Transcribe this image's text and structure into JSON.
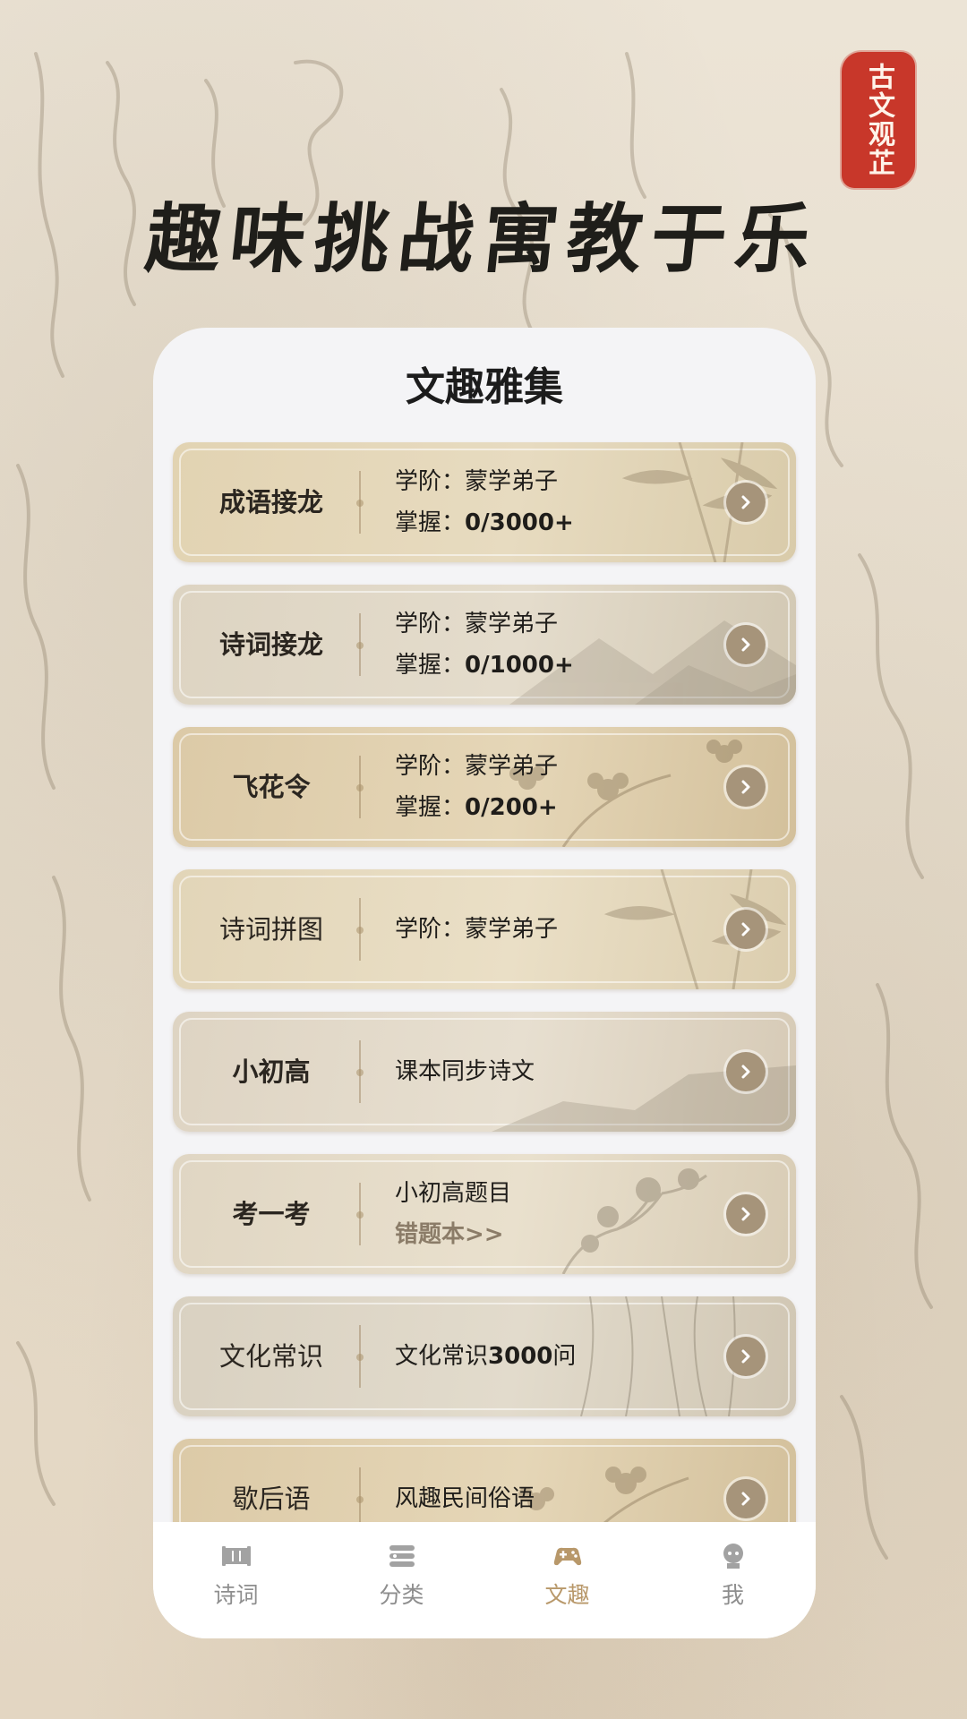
{
  "seal": {
    "text": "古文观芷"
  },
  "headline": "趣味挑战寓教于乐",
  "card": {
    "title": "文趣雅集",
    "items": [
      {
        "name": "成语接龙",
        "line1": "学阶：蒙学弟子",
        "line2_prefix": "掌握：",
        "line2_value": "0/3000+"
      },
      {
        "name": "诗词接龙",
        "line1": "学阶：蒙学弟子",
        "line2_prefix": "掌握：",
        "line2_value": "0/1000+"
      },
      {
        "name": "飞花令",
        "line1": "学阶：蒙学弟子",
        "line2_prefix": "掌握：",
        "line2_value": "0/200+"
      },
      {
        "name": "诗词拼图",
        "line1": "学阶：蒙学弟子"
      },
      {
        "name": "小初高",
        "line1": "课本同步诗文"
      },
      {
        "name": "考一考",
        "line1": "小初高题目",
        "link": "错题本>>"
      },
      {
        "name": "文化常识",
        "line1_prefix": "文化常识",
        "line1_num": "3000",
        "line1_suffix": "问"
      },
      {
        "name": "歇后语",
        "line1": "风趣民间俗语"
      }
    ]
  },
  "tabbar": {
    "tabs": [
      {
        "label": "诗词",
        "icon": "book-icon"
      },
      {
        "label": "分类",
        "icon": "category-icon"
      },
      {
        "label": "文趣",
        "icon": "gamepad-icon",
        "active": true
      },
      {
        "label": "我",
        "icon": "profile-icon"
      }
    ]
  },
  "colors": {
    "seal_red": "#c8372a",
    "active_tab": "#b8986a",
    "inactive_tab": "#8e8e8e",
    "arrow_button": "#a6947a"
  }
}
